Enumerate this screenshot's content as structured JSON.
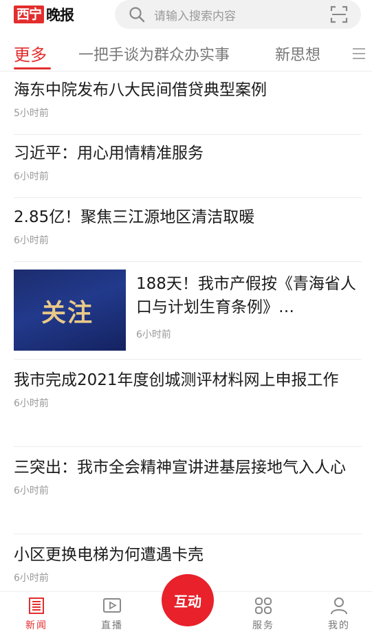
{
  "app": {
    "logo_part1": "西宁",
    "logo_part2": "晚报",
    "accent_color": "#e32d2d"
  },
  "search": {
    "placeholder": "请输入搜索内容",
    "icon": "search-icon",
    "scan_icon": "scan-icon"
  },
  "tabs": [
    {
      "label": "更多",
      "active": true
    },
    {
      "label": "一把手谈为群众办实事",
      "active": false
    },
    {
      "label": "新思想",
      "active": false
    }
  ],
  "news": [
    {
      "title": "海东中院发布八大民间借贷典型案例",
      "time": "5小时前"
    },
    {
      "title": "习近平：用心用情精准服务",
      "time": "6小时前"
    },
    {
      "title": "2.85亿！聚焦三江源地区清洁取暖",
      "time": "6小时前"
    },
    {
      "title": "188天！我市产假按《青海省人口与计划生育条例》…",
      "time": "6小时前",
      "thumb_text": "关注"
    },
    {
      "title": "我市完成2021年度创城测评材料网上申报工作",
      "time": "6小时前"
    },
    {
      "title": "三突出：我市全会精神宣讲进基层接地气入人心",
      "time": "6小时前"
    },
    {
      "title": "小区更换电梯为何遭遇卡壳",
      "time": "6小时前"
    }
  ],
  "bottom_nav": [
    {
      "label": "新闻",
      "icon": "news-icon",
      "active": true
    },
    {
      "label": "直播",
      "icon": "play-icon",
      "active": false
    },
    {
      "label": "互动",
      "icon": "",
      "active": false
    },
    {
      "label": "服务",
      "icon": "grid-icon",
      "active": false
    },
    {
      "label": "我的",
      "icon": "user-icon",
      "active": false
    }
  ]
}
